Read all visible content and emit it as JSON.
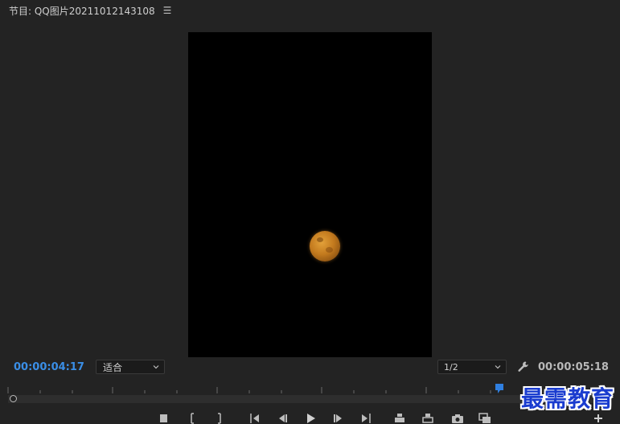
{
  "panel": {
    "title": "节目: QQ图片20211012143108",
    "menu_icon": "☰"
  },
  "controls": {
    "current_timecode": "00:00:04:17",
    "fit_select": "适合",
    "resolution_select": "1/2",
    "duration_timecode": "00:00:05:18"
  },
  "watermark": "最需教育",
  "icons": {
    "settings": "wrench-icon",
    "marker": "marker-flag-icon"
  },
  "colors": {
    "accent_blue": "#3a8ee6",
    "background": "#232323",
    "viewer": "#000000",
    "moon": "#c37a1e"
  }
}
